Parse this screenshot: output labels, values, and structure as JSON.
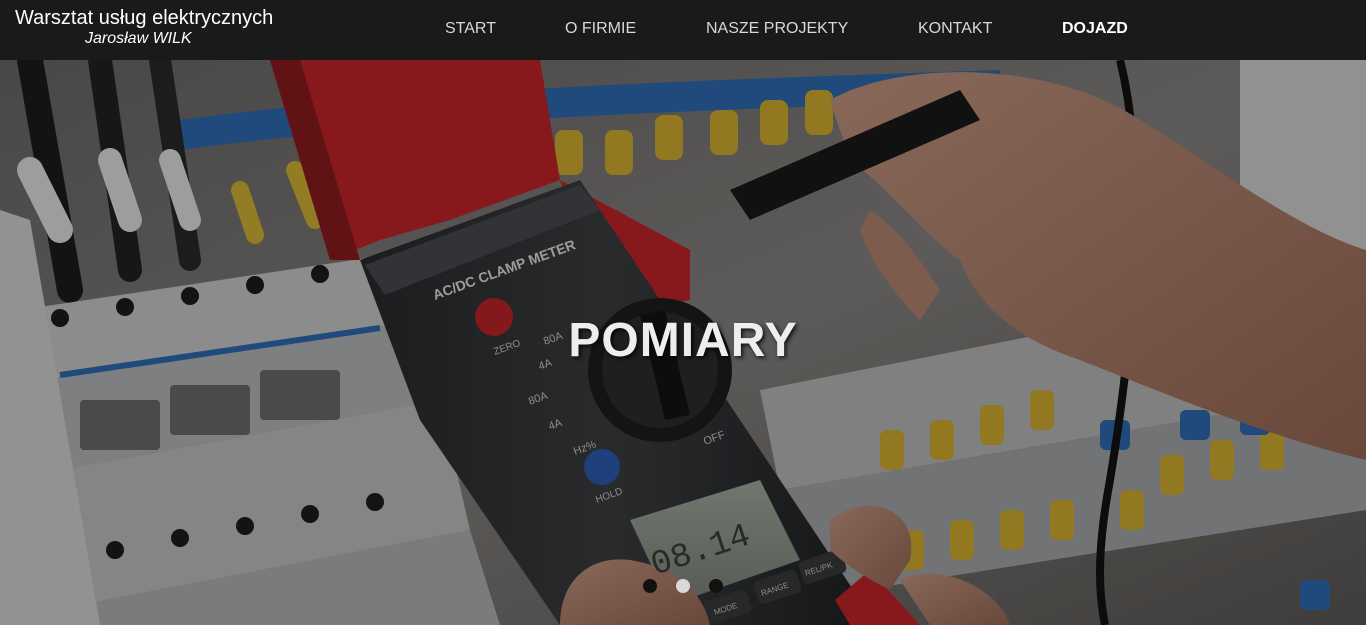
{
  "brand": {
    "title": "Warsztat usług elektrycznych",
    "subtitle": "Jarosław WILK"
  },
  "nav": {
    "items": [
      {
        "label": "START",
        "active": false
      },
      {
        "label": "O FIRMIE",
        "active": false
      },
      {
        "label": "NASZE PROJEKTY",
        "active": false
      },
      {
        "label": "KONTAKT",
        "active": false
      },
      {
        "label": "DOJAZD",
        "active": true
      }
    ]
  },
  "hero": {
    "caption": "POMIARY",
    "image_subject": "clamp-meter-photo",
    "device": {
      "label": "AC/DC CLAMP METER",
      "zero_label": "ZERO",
      "hold_label": "HOLD",
      "display": "08.14",
      "buttons": [
        "MODE",
        "RANGE",
        "REL/PK"
      ],
      "dial_labels": [
        "80A",
        "4A",
        "80A",
        "4A",
        "Hz%",
        "OFF"
      ]
    },
    "slides": {
      "count": 3,
      "active_index": 1
    }
  },
  "colors": {
    "navbar_bg": "#1a1a1a",
    "caption": "#eeeeee",
    "dot_active": "#d9d9d9",
    "dot_inactive": "#111111"
  }
}
